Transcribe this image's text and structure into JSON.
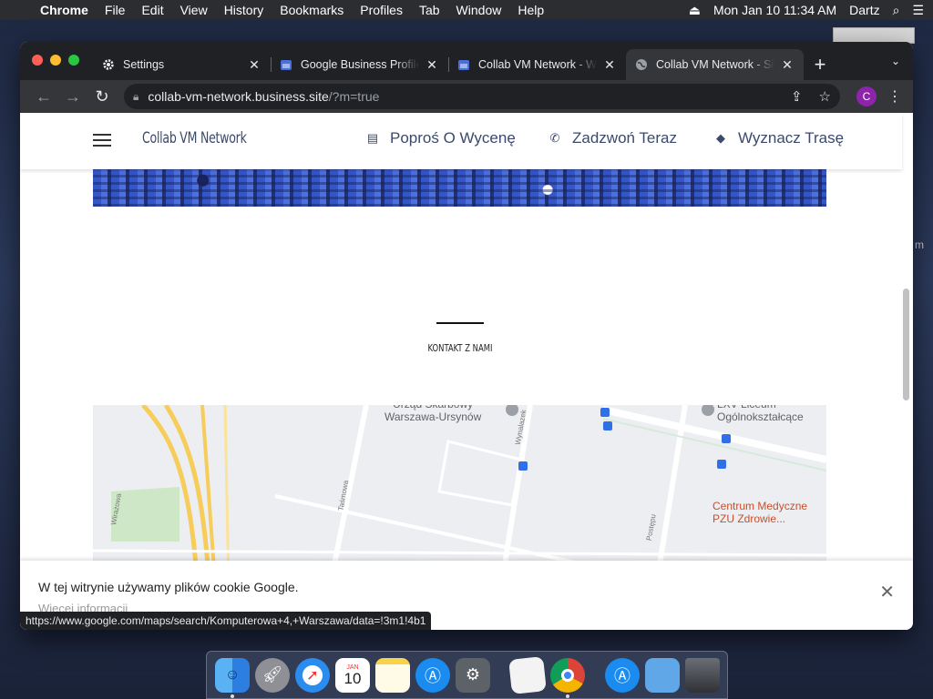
{
  "menubar": {
    "app_name": "Chrome",
    "items": [
      "File",
      "Edit",
      "View",
      "History",
      "Bookmarks",
      "Profiles",
      "Tab",
      "Window",
      "Help"
    ],
    "clock": "Mon Jan 10  11:34 AM",
    "user": "Dartz"
  },
  "tabs": [
    {
      "title": "Settings",
      "icon": "gear-icon"
    },
    {
      "title": "Google Business Profile",
      "icon": "business-profile-icon"
    },
    {
      "title": "Collab VM Network - W",
      "icon": "business-profile-icon"
    },
    {
      "title": "Collab VM Network - Si",
      "icon": "globe-icon",
      "active": true
    }
  ],
  "omnibox": {
    "domain": "collab-vm-network.business.site",
    "path": "/?m=true"
  },
  "profile_initial": "C",
  "site": {
    "brand": "Collab VM Network",
    "nav": {
      "quote": "Poproś O Wycenę",
      "call": "Zadzwoń Teraz",
      "directions": "Wyznacz Trasę"
    },
    "section_title": "KONTAKT Z NAMI",
    "map": {
      "labels": {
        "tax_office": "Urząd Skarbowy\nWarszawa-Ursynów",
        "lyceum": "LXV Liceum\nOgólnokształcące",
        "clinic": "Centrum Medyczne\nPZU Zdrowie...",
        "street_wrazowa": "Wirażowa",
        "street_tasmowa": "Taśmowa",
        "street_wynalazek": "Wynalazek",
        "street_postepu": "Postępu"
      }
    }
  },
  "cookie": {
    "message": "W tej witrynie używamy plików cookie Google.",
    "more": "Więcej informacji"
  },
  "status_url": "https://www.google.com/maps/search/Komputerowa+4,+Warszawa/data=!3m1!4b1",
  "dock": {
    "calendar_month": "JAN",
    "calendar_day": "10"
  },
  "colors": {
    "accent_header": "#3b4a6b",
    "chrome_dark": "#202124",
    "profile": "#8e24aa"
  }
}
